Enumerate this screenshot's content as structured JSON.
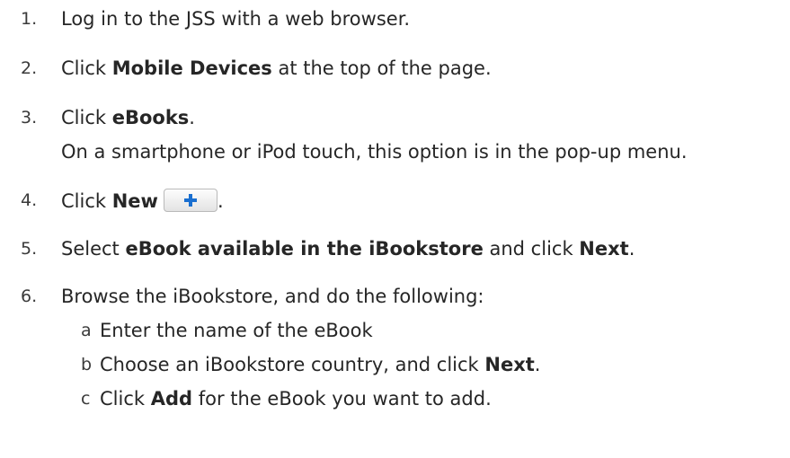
{
  "steps": [
    {
      "num": "1.",
      "text": "Log in to the JSS with a web browser."
    },
    {
      "num": "2.",
      "pre": "Click ",
      "bold": "Mobile Devices",
      "post": " at the top of the page."
    },
    {
      "num": "3.",
      "pre": "Click ",
      "bold": "eBooks",
      "post": ".",
      "note": "On a smartphone or iPod touch, this option is in the pop-up menu."
    },
    {
      "num": "4.",
      "pre": "Click ",
      "bold": "New",
      "post": "."
    },
    {
      "num": "5.",
      "pre": "Select ",
      "bold": "eBook available in the iBookstore",
      "mid": " and click ",
      "bold2": "Next",
      "post": "."
    },
    {
      "num": "6.",
      "text": "Browse the iBookstore, and do the following:"
    }
  ],
  "substeps": [
    {
      "letter": "a",
      "text": "Enter the name of the eBook"
    },
    {
      "letter": "b",
      "pre": "Choose an iBookstore country, and click ",
      "bold": "Next",
      "post": "."
    },
    {
      "letter": "c",
      "pre": "Click ",
      "bold": "Add",
      "post": " for the eBook you want to add."
    }
  ],
  "icons": {
    "new_button_icon": "plus-icon",
    "plus_color": "#1a6fd0"
  }
}
